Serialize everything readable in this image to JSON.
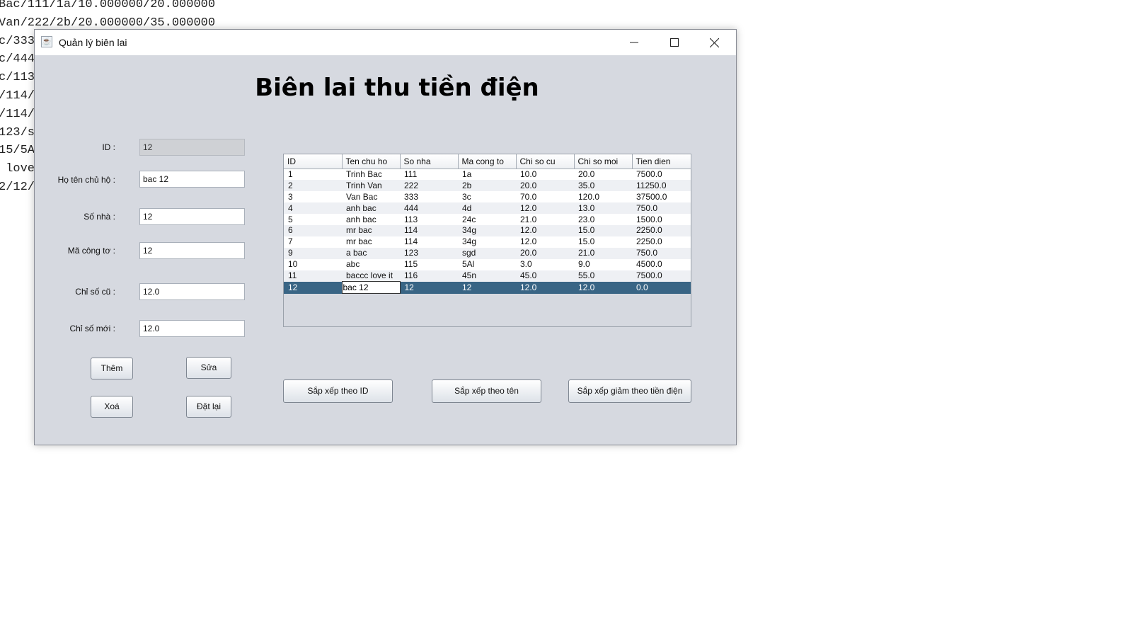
{
  "background_lines": [
    "Bac/111/1a/10.000000/20.000000",
    "Van/222/2b/20.000000/35.000000",
    "c/333",
    "c/444",
    "c/113",
    "/114/",
    "/114/",
    "123/s",
    "15/5A",
    " love",
    "2/12/"
  ],
  "window": {
    "title": "Quản lý biên lai",
    "icon": "java-cup-icon",
    "heading": "Biên lai thu tiền điện"
  },
  "form": {
    "fields": [
      {
        "label": "ID :",
        "value": "12",
        "disabled": true
      },
      {
        "label": "Họ tên chủ hộ :",
        "value": "bac 12",
        "disabled": false
      },
      {
        "label": "Số nhà :",
        "value": "12",
        "disabled": false
      },
      {
        "label": "Mã công tơ :",
        "value": "12",
        "disabled": false
      },
      {
        "label": "Chỉ số cũ :",
        "value": "12.0",
        "disabled": false
      },
      {
        "label": "Chỉ số mới :",
        "value": "12.0",
        "disabled": false
      }
    ],
    "buttons": {
      "add": "Thêm",
      "edit": "Sửa",
      "delete": "Xoá",
      "reset": "Đặt lại"
    }
  },
  "table": {
    "columns": [
      "ID",
      "Ten chu ho",
      "So nha",
      "Ma cong to",
      "Chi so cu",
      "Chi so moi",
      "Tien dien"
    ],
    "rows": [
      [
        "1",
        "Trinh Bac",
        "111",
        "1a",
        "10.0",
        "20.0",
        "7500.0"
      ],
      [
        "2",
        "Trinh Van",
        "222",
        "2b",
        "20.0",
        "35.0",
        "11250.0"
      ],
      [
        "3",
        "Van Bac",
        "333",
        "3c",
        "70.0",
        "120.0",
        "37500.0"
      ],
      [
        "4",
        "anh bac",
        "444",
        "4d",
        "12.0",
        "13.0",
        "750.0"
      ],
      [
        "5",
        "anh bac",
        "113",
        "24c",
        "21.0",
        "23.0",
        "1500.0"
      ],
      [
        "6",
        "mr bac",
        "114",
        "34g",
        "12.0",
        "15.0",
        "2250.0"
      ],
      [
        "7",
        "mr bac",
        "114",
        "34g",
        "12.0",
        "15.0",
        "2250.0"
      ],
      [
        "9",
        "a bac",
        "123",
        "sgd",
        "20.0",
        "21.0",
        "750.0"
      ],
      [
        "10",
        "abc",
        "115",
        "5Al",
        "3.0",
        "9.0",
        "4500.0"
      ],
      [
        "11",
        "baccc love it",
        "116",
        "45n",
        "45.0",
        "55.0",
        "7500.0"
      ],
      [
        "12",
        "bac 12",
        "12",
        "12",
        "12.0",
        "12.0",
        "0.0"
      ]
    ],
    "selected_row": 10
  },
  "sort_buttons": {
    "by_id": "Sắp xếp theo ID",
    "by_name": "Sắp xếp theo tên",
    "by_bill_desc": "Sắp xếp giảm theo tiền điện"
  },
  "colors": {
    "window_bg": "#d6d9e0",
    "selection": "#396585"
  }
}
